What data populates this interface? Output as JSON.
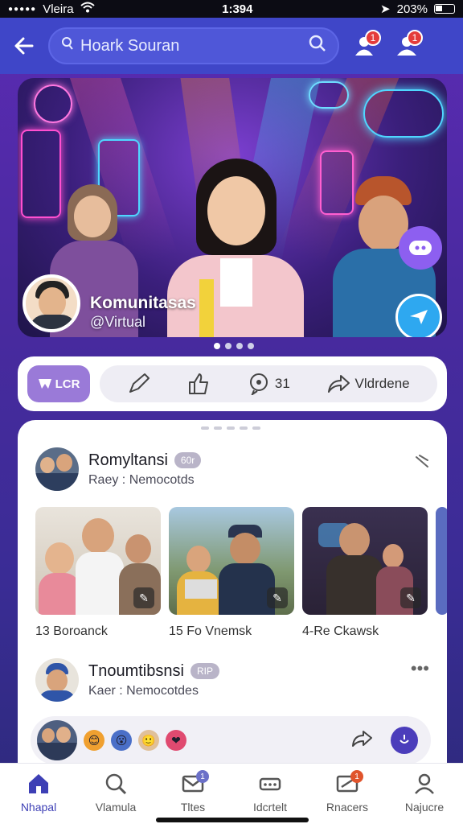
{
  "status": {
    "carrier": "Vleira",
    "time": "1:394",
    "battery": "203%"
  },
  "header": {
    "search_placeholder": "Hoark Souran",
    "badge_1": "1",
    "badge_2": "1"
  },
  "hero": {
    "title": "Komunitasas",
    "subtitle": "@Virtual",
    "active_page": 1,
    "page_count": 4
  },
  "actions": {
    "main_label": "LCR",
    "comment_count": "31",
    "share_label": "Vldrdene"
  },
  "posts": [
    {
      "name": "Romyltansi",
      "tag": "60r",
      "meta": "Raey : Nemocotds",
      "captions": [
        "13 Boroanck",
        "15 Fo Vnemsk",
        "4-Re Ckawsk"
      ]
    },
    {
      "name": "Tnoumtibsnsi",
      "tag": "RIP",
      "meta": "Kaer : Nemocotdes"
    }
  ],
  "nav": [
    {
      "label": "Nhapal",
      "icon": "home-icon"
    },
    {
      "label": "Vlamula",
      "icon": "search-icon"
    },
    {
      "label": "Tltes",
      "icon": "message-icon",
      "badge": "1"
    },
    {
      "label": "Idcrtelt",
      "icon": "dots-icon"
    },
    {
      "label": "Rnacers",
      "icon": "notification-icon",
      "badge": "1"
    },
    {
      "label": "Najucre",
      "icon": "profile-icon"
    }
  ],
  "colors": {
    "primary": "#3f46c8",
    "accent": "#9a7ad8",
    "badge": "#e43b3b"
  }
}
